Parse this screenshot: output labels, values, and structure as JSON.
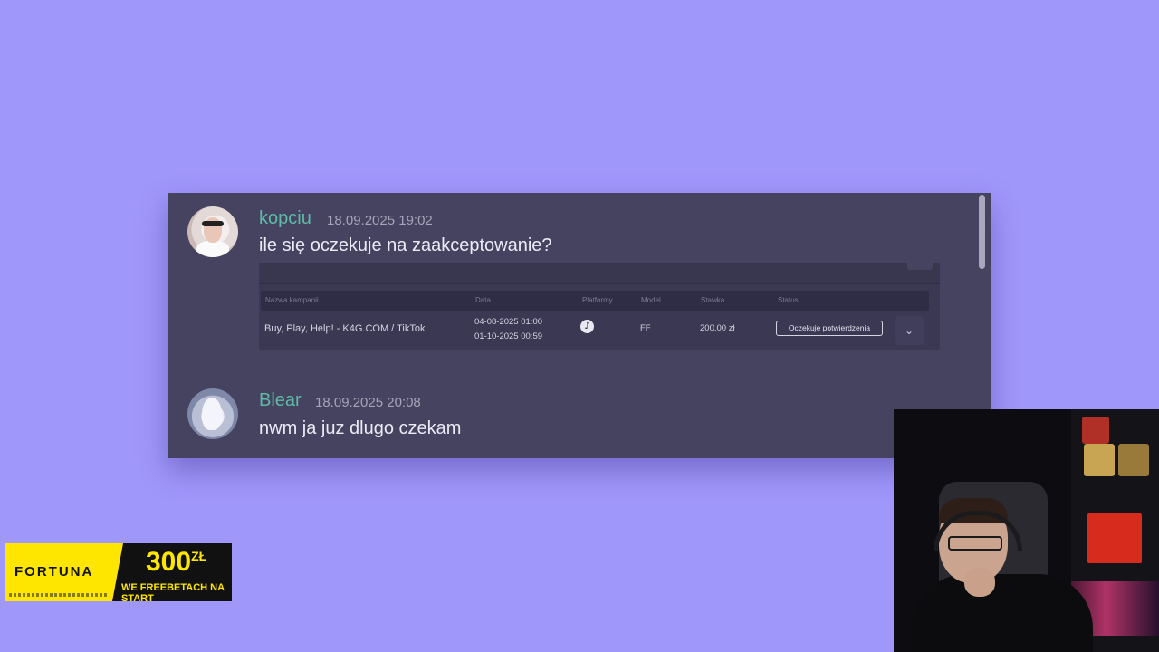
{
  "messages": [
    {
      "username": "kopciu",
      "timestamp": "18.09.2025 19:02",
      "text": "ile się oczekuje na zaakceptowanie?"
    },
    {
      "username": "Blear",
      "timestamp": "18.09.2025 20:08",
      "text": "nwm ja juz dlugo czekam"
    }
  ],
  "embed": {
    "headers": [
      "Nazwa kampanii",
      "Data",
      "Platformy",
      "Model",
      "Stawka",
      "Status"
    ],
    "row": {
      "campaign": "Buy, Play, Help! - K4G.COM / TikTok",
      "date_start": "04-08-2025 01:00",
      "date_end": "01-10-2025 00:59",
      "platform_icon": "tiktok-icon",
      "model": "FF",
      "rate": "200.00 zł",
      "status": "Oczekuje potwierdzenia"
    }
  },
  "ad": {
    "brand": "FORTUNA",
    "amount": "300",
    "currency": "ZŁ",
    "tagline": "WE FREEBETACH NA START",
    "accent": "#ffe600"
  },
  "colors": {
    "background": "#a097fb",
    "chat_bg": "#45435f",
    "username": "#5fbaa7"
  }
}
